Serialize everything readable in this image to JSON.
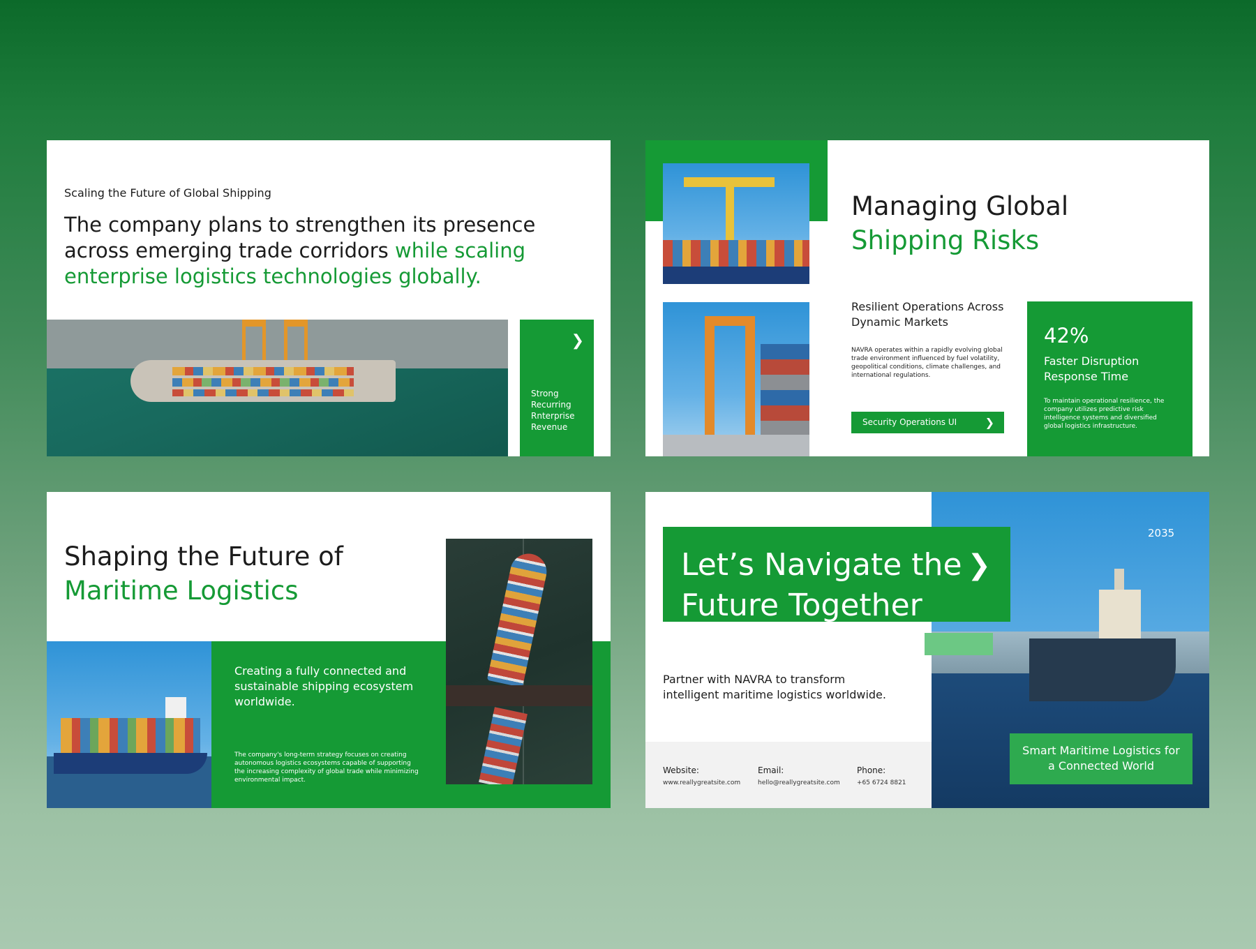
{
  "slides": {
    "slide1": {
      "kicker": "Scaling the Future of Global Shipping",
      "headline_plain": "The company plans to strengthen its presence across emerging trade corridors ",
      "headline_green": "while scaling enterprise logistics technologies globally.",
      "card_label": "Strong Recurring Rnterprise Revenue",
      "card_arrow": "❯"
    },
    "slide2": {
      "title_line1": "Managing Global",
      "title_line2": "Shipping Risks",
      "subtitle": "Resilient Operations Across Dynamic Markets",
      "paragraph": "NAVRA operates within a rapidly evolving global trade environment influenced by fuel volatility, geopolitical conditions, climate challenges, and international regulations.",
      "button_label": "Security Operations UI",
      "button_arrow": "❯",
      "stat_value": "42%",
      "stat_label": "Faster Disruption Response Time",
      "stat_desc": "To maintain operational resilience, the company utilizes predictive risk intelligence systems and diversified global logistics infrastructure."
    },
    "slide3": {
      "title_line1": "Shaping the Future of",
      "title_line2": "Maritime Logistics",
      "text_primary": "Creating a fully connected and sustainable shipping ecosystem worldwide.",
      "text_secondary": "The company's long-term strategy focuses on creating autonomous logistics ecosystems capable of supporting the increasing complexity of global trade while minimizing environmental impact."
    },
    "slide4": {
      "title_line1": "Let’s Navigate the",
      "title_line2": "Future Together",
      "title_arrow": "❯",
      "year": "2035",
      "partner_text": "Partner with NAVRA to transform intelligent maritime logistics worldwide.",
      "footer": {
        "website_label": "Website:",
        "website_value": "www.reallygreatsite.com",
        "email_label": "Email:",
        "email_value": "hello@reallygreatsite.com",
        "phone_label": "Phone:",
        "phone_value": "+65 6724 8821"
      },
      "tag_text": "Smart Maritime Logistics for a Connected World"
    }
  },
  "colors": {
    "brand_green": "#159a35",
    "light_green": "#6cc884",
    "text_dark": "#1c1c1c"
  }
}
